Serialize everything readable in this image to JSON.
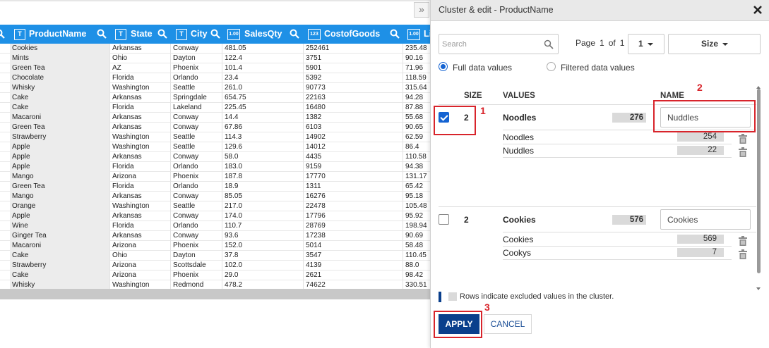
{
  "grid": {
    "columns": [
      {
        "label": "ProductName",
        "type_icon": "T"
      },
      {
        "label": "State",
        "type_icon": "T"
      },
      {
        "label": "City",
        "type_icon": "T"
      },
      {
        "label": "SalesQty",
        "type_icon": "1.00"
      },
      {
        "label": "CostofGoods",
        "type_icon": "123"
      },
      {
        "label": "Li",
        "type_icon": "1.00"
      }
    ],
    "rows": [
      [
        "Cookies",
        "Arkansas",
        "Conway",
        "481.05",
        "252461",
        "235.48"
      ],
      [
        "Mints",
        "Ohio",
        "Dayton",
        "122.4",
        "3751",
        "90.16"
      ],
      [
        "Green Tea",
        "AZ",
        "Phoenix",
        "101.4",
        "5901",
        "71.96"
      ],
      [
        "Chocolate",
        "Florida",
        "Orlando",
        "23.4",
        "5392",
        "118.59"
      ],
      [
        "Whisky",
        "Washington",
        "Seattle",
        "261.0",
        "90773",
        "315.64"
      ],
      [
        "Cake",
        "Arkansas",
        "Springdale",
        "654.75",
        "22163",
        "94.28"
      ],
      [
        "Cake",
        "Florida",
        "Lakeland",
        "225.45",
        "16480",
        "87.88"
      ],
      [
        "Macaroni",
        "Arkansas",
        "Conway",
        "14.4",
        "1382",
        "55.68"
      ],
      [
        "Green Tea",
        "Arkansas",
        "Conway",
        "67.86",
        "6103",
        "90.65"
      ],
      [
        "Strawberry",
        "Washington",
        "Seattle",
        "114.3",
        "14902",
        "62.59"
      ],
      [
        "Apple",
        "Washington",
        "Seattle",
        "129.6",
        "14012",
        "86.4"
      ],
      [
        "Apple",
        "Arkansas",
        "Conway",
        "58.0",
        "4435",
        "110.58"
      ],
      [
        "Apple",
        "Florida",
        "Orlando",
        "183.0",
        "9159",
        "94.38"
      ],
      [
        "Mango",
        "Arizona",
        "Phoenix",
        "187.8",
        "17770",
        "131.17"
      ],
      [
        "Green Tea",
        "Florida",
        "Orlando",
        "18.9",
        "1311",
        "65.42"
      ],
      [
        "Mango",
        "Arkansas",
        "Conway",
        "85.05",
        "16276",
        "95.18"
      ],
      [
        "Orange",
        "Washington",
        "Seattle",
        "217.0",
        "22478",
        "105.48"
      ],
      [
        "Apple",
        "Arkansas",
        "Conway",
        "174.0",
        "17796",
        "95.92"
      ],
      [
        "Wine",
        "Florida",
        "Orlando",
        "110.7",
        "28769",
        "198.94"
      ],
      [
        "Ginger Tea",
        "Arkansas",
        "Conway",
        "93.6",
        "17238",
        "90.69"
      ],
      [
        "Macaroni",
        "Arizona",
        "Phoenix",
        "152.0",
        "5014",
        "58.48"
      ],
      [
        "Cake",
        "Ohio",
        "Dayton",
        "37.8",
        "3547",
        "110.45"
      ],
      [
        "Strawberry",
        "Arizona",
        "Scottsdale",
        "102.0",
        "4139",
        "88.0"
      ],
      [
        "Cake",
        "Arizona",
        "Phoenix",
        "29.0",
        "2621",
        "98.42"
      ],
      [
        "Whisky",
        "Washington",
        "Redmond",
        "478.2",
        "74622",
        "330.51"
      ]
    ]
  },
  "panel": {
    "collapse_glyph": "»",
    "title": "Cluster & edit - ProductName",
    "search_placeholder": "Search",
    "page_prefix": "Page",
    "page_current": "1",
    "page_of": "of",
    "page_total": "1",
    "page_select": "1",
    "size_select": "Size",
    "radio_full": "Full data values",
    "radio_filtered": "Filtered data values",
    "radio_selected": "full",
    "headers": {
      "size": "SIZE",
      "values": "VALUES",
      "name": "NAME"
    },
    "clusters": [
      {
        "checked": true,
        "size": "2",
        "value": "Noodles",
        "count": "276",
        "name": "Nuddles",
        "members": [
          {
            "label": "Noodles",
            "count": "254"
          },
          {
            "label": "Nuddles",
            "count": "22"
          }
        ]
      },
      {
        "checked": false,
        "size": "2",
        "value": "Cookies",
        "count": "576",
        "name": "Cookies",
        "members": [
          {
            "label": "Cookies",
            "count": "569"
          },
          {
            "label": "Cookys",
            "count": "7"
          }
        ]
      }
    ],
    "legend": "Rows indicate excluded values in the cluster.",
    "apply_label": "APPLY",
    "cancel_label": "CANCEL"
  },
  "annotations": {
    "callout_1": "1",
    "callout_2": "2",
    "callout_3": "3"
  },
  "colors": {
    "header_blue": "#1e90e6",
    "primary_navy": "#0a3f8c",
    "annotation_red": "#d8242b"
  }
}
